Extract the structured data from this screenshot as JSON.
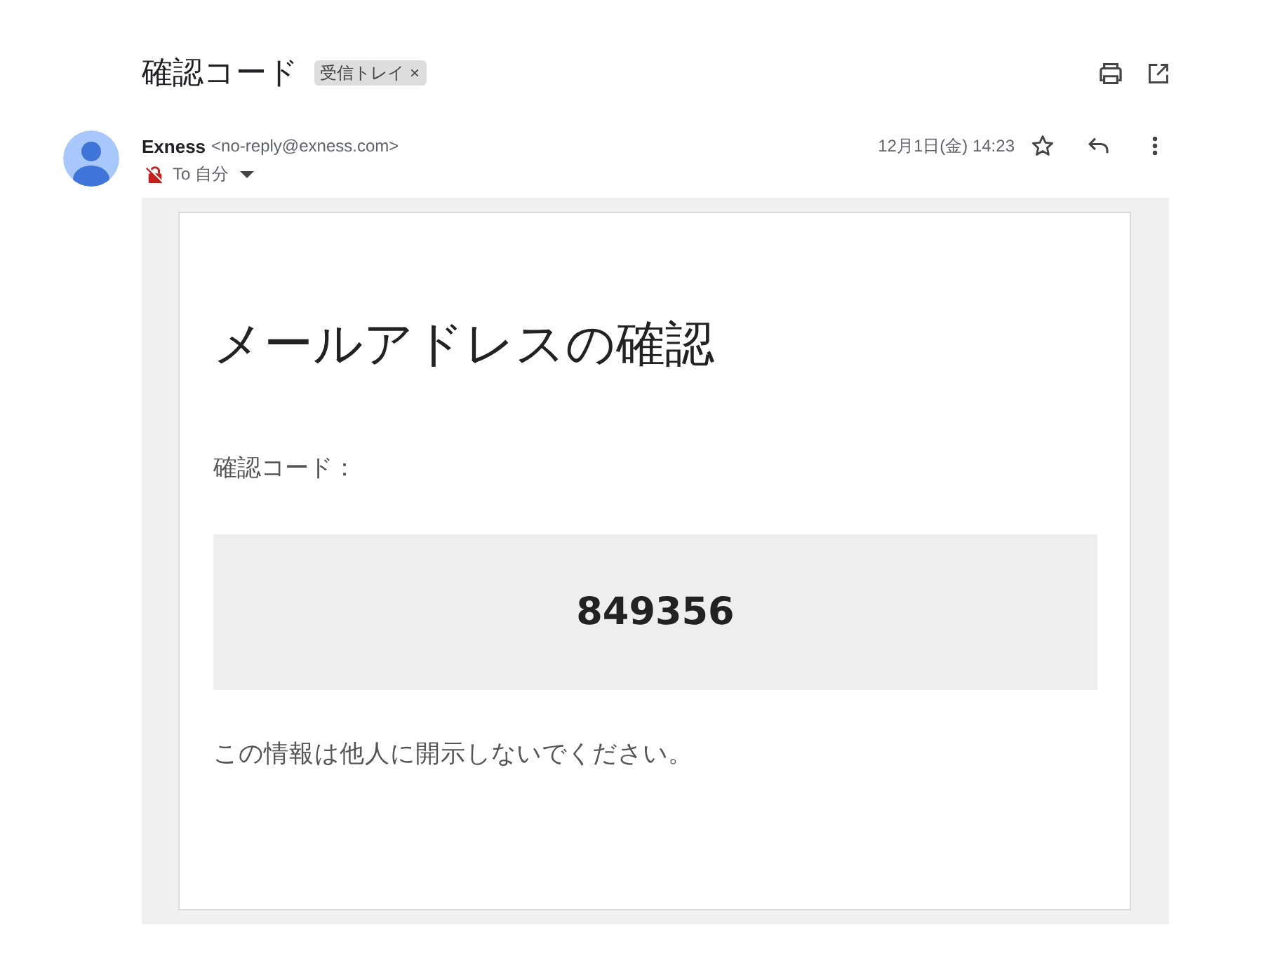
{
  "subject": {
    "title": "確認コード",
    "label": {
      "text": "受信トレイ",
      "remove": "×"
    }
  },
  "message": {
    "sender_name": "Exness",
    "sender_email": "<no-reply@exness.com>",
    "recipient": "To 自分",
    "date": "12月1日(金) 14:23",
    "starred": false
  },
  "email_body": {
    "heading": "メールアドレスの確認",
    "code_label": "確認コード：",
    "code": "849356",
    "note": "この情報は他人に開示しないでください。"
  }
}
